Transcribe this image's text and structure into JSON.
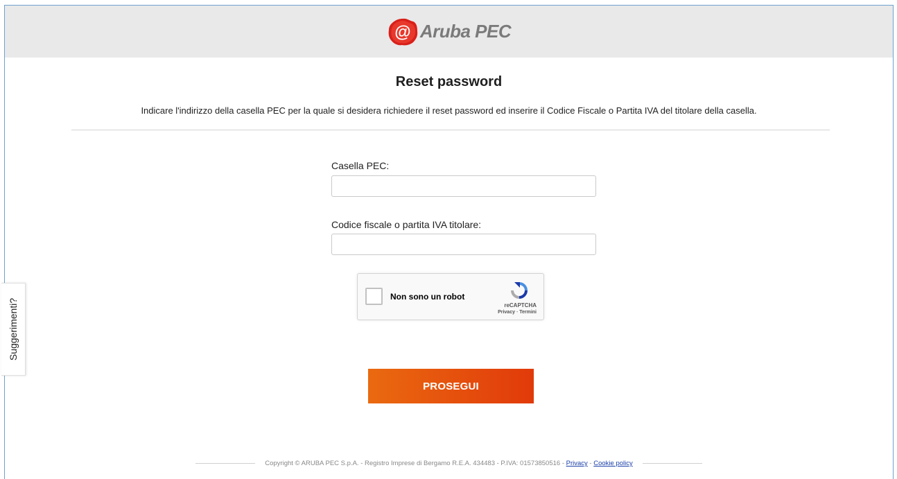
{
  "header": {
    "logo_text": "Aruba PEC",
    "accent_color": "#e2231a"
  },
  "page": {
    "title": "Reset password",
    "instructions": "Indicare l'indirizzo della casella PEC per la quale si desidera richiedere il reset password ed inserire il Codice Fiscale o Partita IVA del titolare della casella."
  },
  "form": {
    "pec_label": "Casella PEC:",
    "pec_value": "",
    "tax_label": "Codice fiscale o partita IVA titolare:",
    "tax_value": "",
    "submit_label": "PROSEGUI",
    "submit_colors": [
      "#ea6a10",
      "#e13a0a"
    ]
  },
  "captcha": {
    "label": "Non sono un robot",
    "brand": "reCAPTCHA",
    "privacy": "Privacy",
    "separator": " - ",
    "terms": "Termini",
    "checked": false
  },
  "side_tab": {
    "label": "Suggerimenti?"
  },
  "footer": {
    "copyright": "Copyright © ARUBA PEC S.p.A. - Registro Imprese di Bergamo R.E.A. 434483 - P.IVA: 01573850516 - ",
    "privacy_link": "Privacy",
    "separator": " - ",
    "cookie_link": "Cookie policy"
  }
}
